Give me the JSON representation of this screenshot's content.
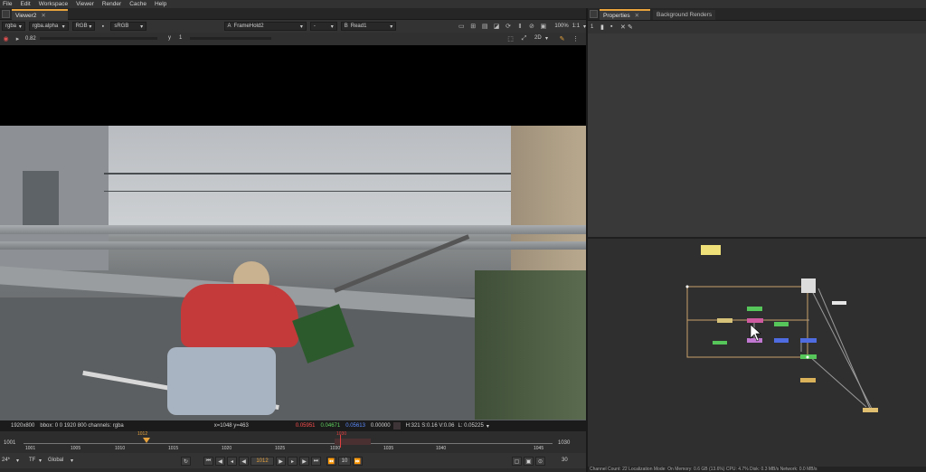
{
  "menubar": {
    "items": [
      "File",
      "Edit",
      "Workspace",
      "Viewer",
      "Render",
      "Cache",
      "Help"
    ]
  },
  "viewer": {
    "tab_label": "Viewer2",
    "channels": "rgba",
    "alpha": "rgba.alpha",
    "colorspace_mode": "RGB",
    "lut": "sRGB",
    "input_a_label": "A",
    "input_a": "FrameHold2",
    "input_a_sep": "-",
    "input_b_label": "B",
    "input_b": "Read1",
    "zoom": "100%",
    "ratio": "1:1",
    "view_mode": "2D",
    "fstop": "0.82",
    "gain_value": "1",
    "y_label": "y",
    "info": {
      "format": "1920x800",
      "bbox": "bbox: 0 0 1920 800 channels: rgba",
      "coords": "x=1048 y=463",
      "r": "0.05951",
      "g": "0.04671",
      "b": "0.05613",
      "a": "0.00000",
      "hsv": "H:321 S:0.16 V:0.06",
      "luma": "L: 0.05225"
    },
    "colors": {
      "r": "#ff4d4d",
      "g": "#5fd35f",
      "b": "#5b8cff",
      "accent": "#e8a33d"
    }
  },
  "timeline": {
    "start": "1001",
    "end": "1030",
    "ticks": [
      "1001",
      "1005",
      "1010",
      "1015",
      "1020",
      "1025",
      "1030",
      "1035",
      "1040",
      "1045"
    ],
    "marker_in": "1012",
    "marker_playhead": "1030",
    "current_frame": "1012",
    "fps": "24*",
    "tf": "TF",
    "range_mode": "Global",
    "step": "10",
    "end_field": "30"
  },
  "properties": {
    "tab_label": "Properties",
    "bg_tab_label": "Background Renders",
    "max_panels": "1"
  },
  "status": {
    "text": "Channel Count: 22  Localization Mode: On  Memory: 0.6 GB (13.6%)  CPU: 4.7%  Disk: 0.3 MB/s  Network: 0.0 MB/s"
  }
}
